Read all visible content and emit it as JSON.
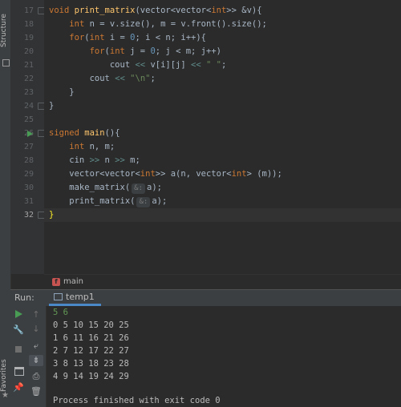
{
  "toolstrip": {
    "structure_label": "Structure",
    "favorites_label": "Favorites"
  },
  "editor": {
    "line_numbers": [
      "17",
      "18",
      "19",
      "20",
      "21",
      "22",
      "23",
      "24",
      "25",
      "26",
      "27",
      "28",
      "29",
      "30",
      "31",
      "32"
    ],
    "current_line": "32",
    "hints": {
      "line30_hint": "&:",
      "line31_hint": "&:"
    }
  },
  "breadcrumb": {
    "label": "main",
    "icon": "function-icon"
  },
  "run": {
    "title": "Run:",
    "tab_label": "temp1",
    "console_input": "5 6",
    "console_output": [
      "0 5 10 15 20 25",
      "1 6 11 16 21 26",
      "2 7 12 17 22 27",
      "3 8 13 18 23 28",
      "4 9 14 19 24 29"
    ],
    "exit_message": "Process finished with exit code 0"
  },
  "colors": {
    "keyword": "#cc7832",
    "function": "#ffc66d",
    "number": "#6897bb",
    "string": "#6a8759",
    "input_text": "#629755"
  }
}
